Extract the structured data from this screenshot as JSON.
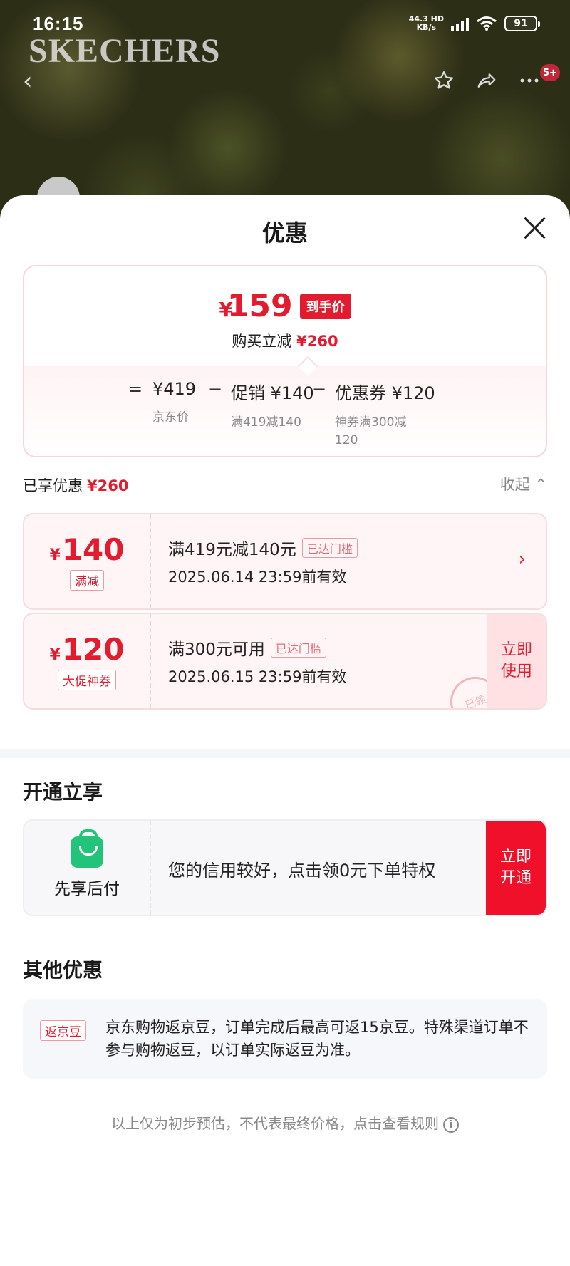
{
  "status_bar": {
    "time": "16:15",
    "net_speed": "44.3",
    "net_unit": "KB/s",
    "hd": "HD",
    "battery": "91"
  },
  "brand": "SKECHERS",
  "nav": {
    "badge": "5+"
  },
  "sheet": {
    "title": "优惠"
  },
  "price": {
    "currency": "¥",
    "final": "159",
    "final_tag": "到手价",
    "saving_label": "购买立减",
    "saving_value": "¥260",
    "calc": {
      "eq": "=",
      "minus": "−",
      "jd_price": "¥419",
      "jd_price_desc": "京东价",
      "promo": "促销 ¥140",
      "promo_desc": "满419减140",
      "coupon": "优惠券 ¥120",
      "coupon_desc": "神券满300减120"
    }
  },
  "enjoyed": {
    "label": "已享优惠",
    "value": "¥260",
    "collapse": "收起"
  },
  "coupons": [
    {
      "currency": "¥",
      "value": "140",
      "type": "满减",
      "title": "满419元减140元",
      "chip": "已达门槛",
      "expiry": "2025.06.14 23:59前有效"
    },
    {
      "currency": "¥",
      "value": "120",
      "type": "大促神券",
      "title": "满300元可用",
      "chip": "已达门槛",
      "expiry": "2025.06.15 23:59前有效",
      "action": "立即使用",
      "stamp": "已领"
    }
  ],
  "open_section": {
    "title": "开通立享",
    "left_label": "先享后付",
    "text": "您的信用较好，点击领0元下单特权",
    "action": "立即开通"
  },
  "other_section": {
    "title": "其他优惠",
    "tag": "返京豆",
    "text": "京东购物返京豆，订单完成后最高可返15京豆。特殊渠道订单不参与购物返豆，以订单实际返豆为准。"
  },
  "footer": "以上仅为初步预估，不代表最终价格，点击查看规则",
  "colors": {
    "accent": "#e31b2e",
    "green": "#22c47a",
    "bg_pink": "#fff5f6"
  }
}
